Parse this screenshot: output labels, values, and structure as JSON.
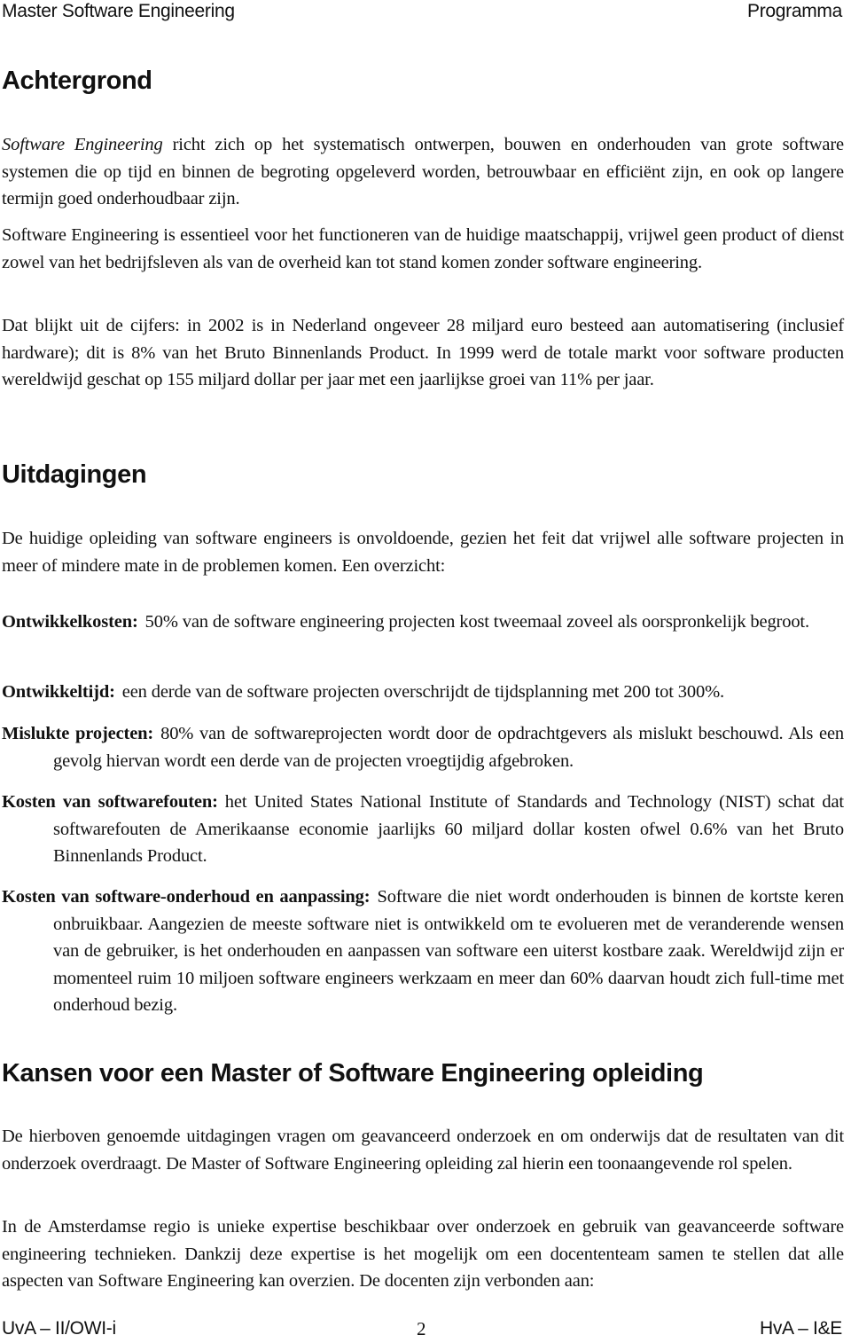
{
  "header": {
    "left": "Master Software Engineering",
    "right": "Programma"
  },
  "sections": {
    "achtergrond": {
      "title": "Achtergrond",
      "p1_italic": "Software Engineering",
      "p1_rest": " richt zich op het systematisch ontwerpen, bouwen en onderhouden van grote software systemen die op tijd en binnen de begroting opgeleverd worden, betrouwbaar en efficiënt zijn, en ook op langere termijn goed onderhoudbaar zijn.",
      "p2": "Software Engineering is essentieel voor het functioneren van de huidige maatschappij, vrijwel geen product of dienst zowel van het bedrijfsleven als van de overheid kan tot stand komen zonder software engineering.",
      "p3": "Dat blijkt uit de cijfers: in 2002 is in Nederland ongeveer 28 miljard euro besteed aan automatisering (inclusief hardware); dit is 8% van het Bruto Binnenlands Product. In 1999 werd de totale markt voor software producten wereldwijd geschat op 155 miljard dollar per jaar met een jaarlijkse groei van 11% per jaar."
    },
    "uitdagingen": {
      "title": "Uitdagingen",
      "intro": "De huidige opleiding van software engineers is onvoldoende, gezien het feit dat vrijwel alle software projecten in meer of mindere mate in de problemen komen. Een overzicht:",
      "items": [
        {
          "term": "Ontwikkelkosten:",
          "text": "50% van de software engineering projecten kost tweemaal zoveel als oorspronkelijk begroot."
        },
        {
          "term": "Ontwikkeltijd:",
          "text": "een derde van de software projecten overschrijdt de tijdsplanning met 200 tot 300%."
        },
        {
          "term": "Mislukte projecten:",
          "text": "80% van de softwareprojecten wordt door de opdrachtgevers als mislukt beschouwd. Als een gevolg hiervan wordt een derde van de projecten vroegtijdig afgebroken."
        },
        {
          "term": "Kosten van softwarefouten:",
          "text": "het United States National Institute of Standards and Technology (NIST) schat dat softwarefouten de Amerikaanse economie jaarlijks 60 miljard dollar kosten ofwel 0.6% van het Bruto Binnenlands Product."
        },
        {
          "term": "Kosten van software-onderhoud en aanpassing:",
          "text": "Software die niet wordt onderhouden is binnen de kortste keren onbruikbaar.  Aangezien de meeste software niet is ontwikkeld om te evolueren met de veranderende wensen van de gebruiker, is het onderhouden en aanpassen van software een uiterst kostbare zaak.  Wereldwijd zijn er momenteel ruim 10 miljoen software engineers werkzaam en meer dan 60% daarvan houdt zich full-time met onderhoud bezig."
        }
      ]
    },
    "kansen": {
      "title": "Kansen voor een Master of Software Engineering opleiding",
      "p1": "De hierboven genoemde uitdagingen vragen om geavanceerd onderzoek en om onderwijs dat de resultaten van dit onderzoek overdraagt.  De Master of Software Engineering opleiding zal hierin een toonaangevende rol spelen.",
      "p2": "In de Amsterdamse regio is unieke expertise beschikbaar over onderzoek en gebruik van geavanceerde software engineering technieken. Dankzij deze expertise is het mogelijk om een docententeam samen te stellen dat alle aspecten van Software Engineering kan overzien. De docenten zijn verbonden aan:"
    }
  },
  "footer": {
    "left": "UvA – II/OWI-i",
    "page_number": "2",
    "right": "HvA – I&E"
  }
}
